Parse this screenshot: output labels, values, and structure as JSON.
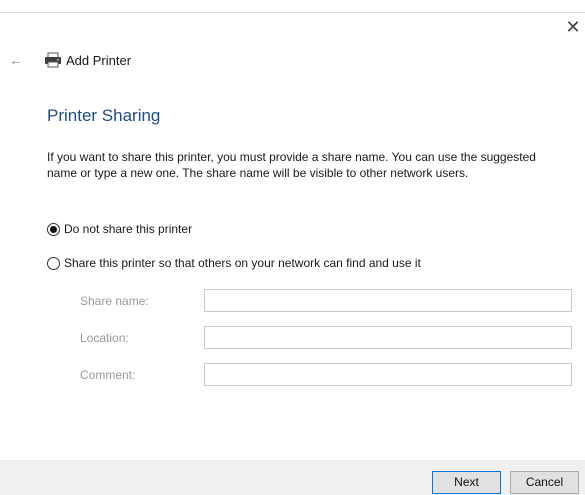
{
  "window": {
    "title": "Add Printer",
    "close_glyph": "✕",
    "back_glyph": "←",
    "icons": {
      "close": "close-icon",
      "back": "back-arrow-icon",
      "printer": "printer-icon"
    }
  },
  "page": {
    "heading": "Printer Sharing",
    "description": "If you want to share this printer, you must provide a share name. You can use the suggested name or type a new one. The share name will be visible to other network users."
  },
  "options": {
    "do_not_share": {
      "label": "Do not share this printer",
      "selected": true
    },
    "share": {
      "label": "Share this printer so that others on your network can find and use it",
      "selected": false
    }
  },
  "fields": {
    "share_name": {
      "label": "Share name:",
      "value": ""
    },
    "location": {
      "label": "Location:",
      "value": ""
    },
    "comment": {
      "label": "Comment:",
      "value": ""
    }
  },
  "buttons": {
    "next": "Next",
    "cancel": "Cancel"
  },
  "colors": {
    "heading": "#1e4b8a",
    "primary_button_border": "#0078d7",
    "footer_bg": "#f0f0f0",
    "disabled_label": "#9a9a9a"
  }
}
